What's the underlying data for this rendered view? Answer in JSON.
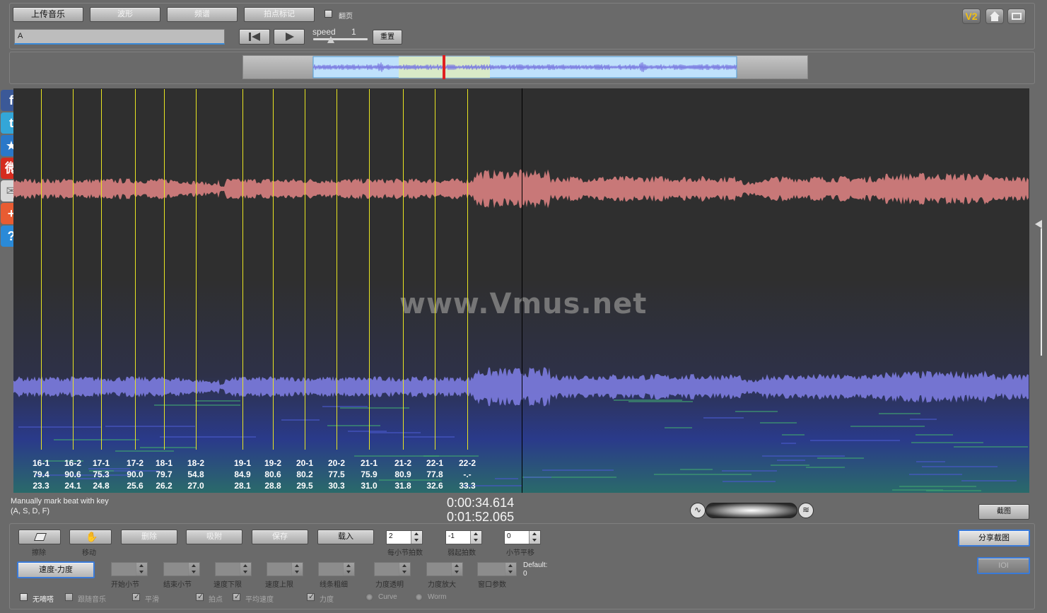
{
  "toolbar": {
    "upload_label": "上传音乐",
    "waveform_label": "波形",
    "spectrum_label": "频谱",
    "beat_mark_label": "拍点标记",
    "page_flip_label": "翻页",
    "page_flip_checked": false,
    "text_input_value": "A",
    "speed_label": "speed",
    "speed_value": "1",
    "reset_label": "重置"
  },
  "top_right": {
    "v2_label": "V2",
    "home_icon": "home-icon",
    "fullscreen_icon": "fullscreen-icon"
  },
  "overview": {
    "colors": {
      "background": "#b0b0b0",
      "visible_range": "#bfe1fb",
      "selection": "#d9eac8",
      "cursor": "#e02020",
      "wave": "#7a7ae0"
    }
  },
  "social_bar": [
    {
      "name": "facebook-icon",
      "glyph": "f",
      "color": "#3b5998"
    },
    {
      "name": "twitter-icon",
      "glyph": "t",
      "color": "#33a6d8"
    },
    {
      "name": "favorite-star-icon",
      "glyph": "★",
      "color": "#2a78c8"
    },
    {
      "name": "weibo-icon",
      "glyph": "微",
      "color": "#d52b1e"
    },
    {
      "name": "mail-icon",
      "glyph": "✉",
      "color": "#d8d8d8"
    },
    {
      "name": "add-share-icon",
      "glyph": "+",
      "color": "#e85c32"
    },
    {
      "name": "help-icon",
      "glyph": "?",
      "color": "#2a8ad8"
    }
  ],
  "viewer": {
    "watermark": "www.Vmus.net",
    "colors": {
      "background": "#2f2f2f",
      "upper_wave": "#c87878",
      "lower_wave": "#7878d8",
      "beat_line": "#e9e622",
      "playhead": "#000000"
    },
    "beats": [
      {
        "label": "16-1",
        "speed": "79.4",
        "time": "23.3"
      },
      {
        "label": "16-2",
        "speed": "90.6",
        "time": "24.1"
      },
      {
        "label": "17-1",
        "speed": "75.3",
        "time": "24.8"
      },
      {
        "label": "17-2",
        "speed": "90.0",
        "time": "25.6"
      },
      {
        "label": "18-1",
        "speed": "79.7",
        "time": "26.2"
      },
      {
        "label": "18-2",
        "speed": "54.8",
        "time": "27.0"
      },
      {
        "label": "19-1",
        "speed": "84.9",
        "time": "28.1"
      },
      {
        "label": "19-2",
        "speed": "80.6",
        "time": "28.8"
      },
      {
        "label": "20-1",
        "speed": "80.2",
        "time": "29.5"
      },
      {
        "label": "20-2",
        "speed": "77.5",
        "time": "30.3"
      },
      {
        "label": "21-1",
        "speed": "75.9",
        "time": "31.0"
      },
      {
        "label": "21-2",
        "speed": "80.9",
        "time": "31.8"
      },
      {
        "label": "22-1",
        "speed": "77.8",
        "time": "32.6"
      },
      {
        "label": "22-2",
        "speed": "-.-",
        "time": "33.3"
      }
    ]
  },
  "status": {
    "hint_line1": "Manually mark beat with key",
    "hint_line2": "(A, S, D, F)",
    "current_time": "0:00:34.614",
    "total_time": "0:01:52.065",
    "screenshot_label": "截图"
  },
  "controls": {
    "erase_label": "擦除",
    "move_label": "移动",
    "delete_label": "删除",
    "snap_label": "吸附",
    "save_label": "保存",
    "load_label": "载入",
    "beats_per_bar_value": "2",
    "beats_per_bar_label": "每小节拍数",
    "pickup_value": "-1",
    "pickup_label": "弱起拍数",
    "bar_offset_value": "0",
    "bar_offset_label": "小节平移",
    "speed_dynamics_label": "速度-力度",
    "start_bar_label": "开始小节",
    "end_bar_label": "结束小节",
    "speed_min_label": "速度下限",
    "speed_max_label": "速度上限",
    "line_width_label": "线条粗细",
    "dynamics_alpha_label": "力度透明",
    "dynamics_scale_label": "力度放大",
    "window_param_label": "窗口参数",
    "default_label": "Default:",
    "default_value": "0",
    "share_screenshot_label": "分享截图",
    "ioi_label": "IOI"
  },
  "options": [
    {
      "label": "无嘀嗒",
      "type": "checkbox",
      "checked": false
    },
    {
      "label": "跟随音乐",
      "type": "checkbox",
      "checked": false
    },
    {
      "label": "平滑",
      "type": "checkbox",
      "checked": true
    },
    {
      "label": "拍点",
      "type": "checkbox",
      "checked": true
    },
    {
      "label": "平均速度",
      "type": "checkbox",
      "checked": true
    },
    {
      "label": "力度",
      "type": "checkbox",
      "checked": true
    },
    {
      "label": "Curve",
      "type": "radio",
      "checked": true
    },
    {
      "label": "Worm",
      "type": "radio",
      "checked": false
    }
  ]
}
